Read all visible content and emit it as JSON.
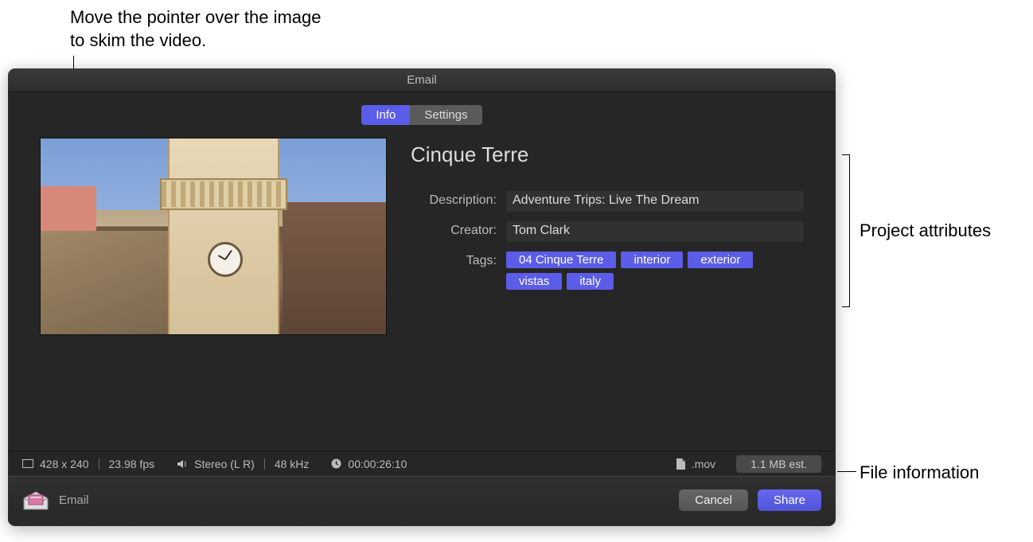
{
  "annotations": {
    "top": "Move the pointer over the image to skim the video.",
    "right": "Project attributes",
    "bottom": "File information"
  },
  "window": {
    "title": "Email"
  },
  "tabs": {
    "info": "Info",
    "settings": "Settings"
  },
  "project": {
    "title": "Cinque Terre",
    "description_label": "Description:",
    "description_value": "Adventure Trips: Live The Dream",
    "creator_label": "Creator:",
    "creator_value": "Tom Clark",
    "tags_label": "Tags:"
  },
  "tags": {
    "t0": "04 Cinque Terre",
    "t1": "interior",
    "t2": "exterior",
    "t3": "vistas",
    "t4": "italy"
  },
  "fileinfo": {
    "dimensions": "428 x 240",
    "fps": "23.98 fps",
    "audio": "Stereo (L R)",
    "audiorate": "48 kHz",
    "duration": "00:00:26:10",
    "extension": ".mov",
    "size_est": "1.1 MB est."
  },
  "footer": {
    "destination": "Email",
    "cancel": "Cancel",
    "share": "Share"
  }
}
